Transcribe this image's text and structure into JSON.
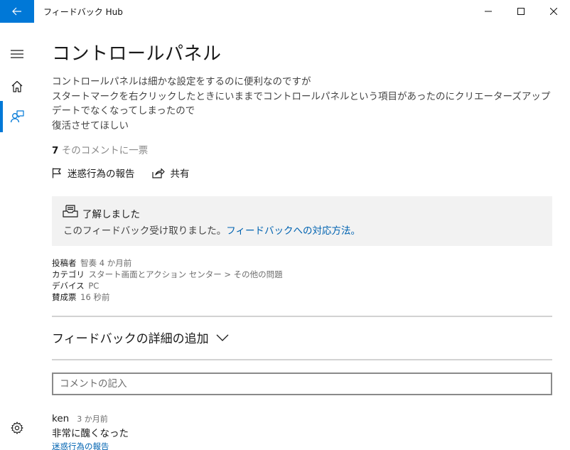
{
  "app": {
    "title": "フィードバック Hub"
  },
  "window_controls": {
    "minimize": "minimize",
    "maximize": "maximize",
    "close": "close"
  },
  "nav": {
    "items": [
      {
        "icon": "hamburger-menu-icon"
      },
      {
        "icon": "home-icon"
      },
      {
        "icon": "feedback-icon",
        "selected": true
      },
      {
        "icon": "settings-gear-icon"
      }
    ]
  },
  "feedback": {
    "title": "コントロールパネル",
    "description_lines": [
      "コントロールパネルは細かな設定をするのに便利なのですが",
      "スタートマークを右クリックしたときにいままでコントロールパネルという項目があったのにクリエーターズアップデートでなくなってしまったので",
      "復活させてほしい"
    ],
    "vote_count": "7",
    "vote_label": "そのコメントに一票",
    "actions": {
      "report": "迷惑行為の報告",
      "share": "共有"
    },
    "acknowledgement": {
      "title": "了解しました",
      "text": "このフィードバック受け取りました。",
      "link": "フィードバックへの対応方法。"
    },
    "meta": {
      "poster_label": "投稿者",
      "poster_value": "智奏 4 か月前",
      "category_label": "カテゴリ",
      "category_value": "スタート画面とアクション センター > その他の問題",
      "device_label": "デバイス",
      "device_value": "PC",
      "upvote_label": "賛成票",
      "upvote_value": "16 秒前"
    },
    "add_details_label": "フィードバックの詳細の追加",
    "comment_placeholder": "コメントの記入",
    "comments": [
      {
        "author": "ken",
        "time": "3 か月前",
        "text": "非常に醜くなった",
        "report": "迷惑行為の報告"
      }
    ]
  },
  "colors": {
    "accent": "#0078d7",
    "link": "#0063b1",
    "ack_background": "#f2f2f2"
  }
}
